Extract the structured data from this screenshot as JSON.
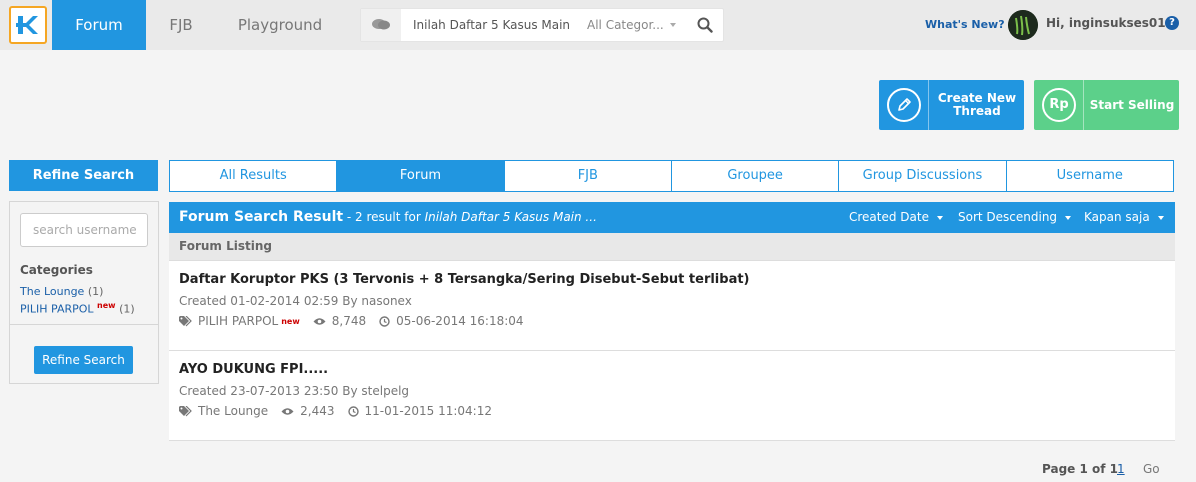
{
  "nav": {
    "tabs": [
      "Forum",
      "FJB",
      "Playground"
    ],
    "active_tab": "Forum"
  },
  "search": {
    "query": "Inilah Daftar 5 Kasus Main",
    "category": "All Categor..."
  },
  "header": {
    "whats_new": "What's New?",
    "greeting": "Hi, inginsukses01",
    "help": "?"
  },
  "actions": {
    "create_label_1": "Create New",
    "create_label_2": "Thread",
    "sell_label": "Start Selling",
    "sell_icon_text": "Rp"
  },
  "sidebar": {
    "title": "Refine Search",
    "username_placeholder": "search username",
    "categories_title": "Categories",
    "categories": [
      {
        "label": "The Lounge",
        "count": "(1)",
        "badge": ""
      },
      {
        "label": "PILIH PARPOL",
        "count": "(1)",
        "badge": "new"
      }
    ],
    "refine_button": "Refine Search"
  },
  "result_tabs": [
    "All Results",
    "Forum",
    "FJB",
    "Groupee",
    "Group Discussions",
    "Username"
  ],
  "results": {
    "title": "Forum Search Result",
    "summary_prefix": " - 2 result for ",
    "summary_query": "Inilah Daftar 5 Kasus Main ...",
    "filters": [
      "Created Date",
      "Sort Descending",
      "Kapan saja"
    ],
    "listing_label": "Forum Listing",
    "threads": [
      {
        "title": "Daftar Koruptor PKS (3 Tervonis + 8 Tersangka/Sering Disebut-Sebut terlibat)",
        "created": "Created 01-02-2014 02:59 By nasonex",
        "category": "PILIH PARPOL",
        "category_badge": "new",
        "views": "8,748",
        "last_post": "05-06-2014 16:18:04"
      },
      {
        "title": "AYO DUKUNG FPI.....",
        "created": "Created 23-07-2013 23:50 By stelpelg",
        "category": "The Lounge",
        "category_badge": "",
        "views": "2,443",
        "last_post": "11-01-2015 11:04:12"
      }
    ]
  },
  "pagination": {
    "label": "Page 1 of 1",
    "current": "1",
    "go": "Go"
  },
  "colors": {
    "primary": "#2196e0",
    "selling": "#5cd08a",
    "logo_border": "#f5a623",
    "link": "#1a5fa8"
  }
}
